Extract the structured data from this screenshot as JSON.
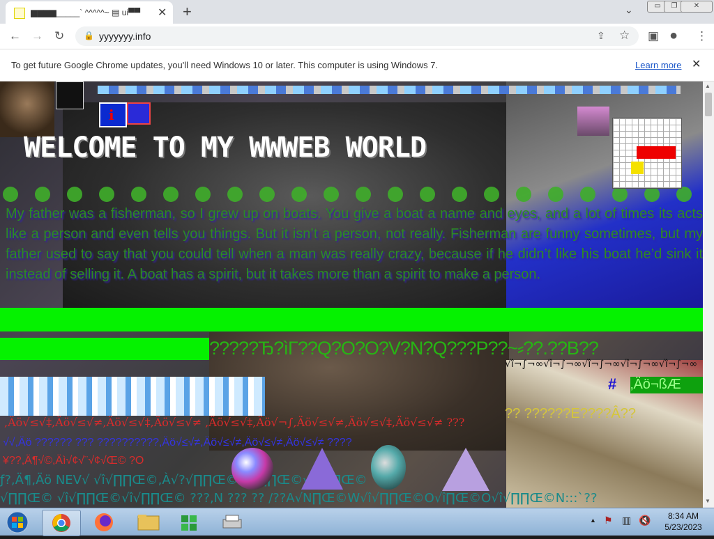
{
  "browser": {
    "tab_title": "▆▆▆▆_____` ^^^^^~ ▤ ui▀▀",
    "tab_close": "✕",
    "new_tab": "+",
    "tab_list": "⌄",
    "url": "yyyyyyy.info",
    "win_minimize": "▭",
    "win_restore": "❐",
    "win_close": "✕"
  },
  "infobar": {
    "message": "To get future Google Chrome updates, you'll need Windows 10 or later. This computer is using Windows 7.",
    "learn_more": "Learn more",
    "close": "✕"
  },
  "page": {
    "welcome": "WELCOME TO MY WWWEB WORLD",
    "story": "My father was a fisherman, so I grew up on boats. You give a boat a name and eyes, and a lot of times its acts like a person and even tells you things. But it isn’t a person, not really. Fisherman are funny sometimes, but my father used to say that you could tell when a man was really crazy, because if he didn’t like his boat he’d sink it instead of selling it. A boat has a spirit, but it takes more than a spirit to make a person.",
    "question_text": "?????Ђ?ìΓ??Q?O?O?V?N?Q???P??~⸗??.??B??",
    "sqrt_row": "√î¬∫¬∞√î¬∫¬∞√î¬∫¬∞√î¬∫¬∞√î¬∫¬∞",
    "hash_row": "#",
    "hash_green": "‚Äö¬ßÆ",
    "yellow_q": "??  ??????E????Â??",
    "red_row1": ",Äö√≤√‡,Äö√≤√≠,Äö√≤√‡,Äö√≤√≠ ,Äö√≤√‡,Äö√¬∫,Äö√≤√≠,Äö√≤√‡,Äö√≤√≠ ???",
    "red_row2": "√√,Äö ?????? ??? ??????????,Äö√≤√≠,Äö√≤√≠,Äö√≤√≠,Äö√≤√≠ ????",
    "red_row3": "¥??,Ä¶√©,Äì√¢√¨√¢√Œ© ?O",
    "teal_row1": "ƒ?,Ä¶,Äö NEV√ √î√∏∏Œ©,À√?√∏∏Œ©√î√∏∏Œ©√î√∏∏Œ©",
    "teal_row2": "√∏∏Œ© √î√∏∏Œ©√î√∏∏Œ© ???,N ??? ?? /??A√N∏Œ©W√î√∏∏Œ©O√î∏Œ©O√î√∏∏Œ©N:::`??"
  },
  "taskbar": {
    "time": "8:34 AM",
    "date": "5/23/2023"
  },
  "icons": [
    "back-icon",
    "forward-icon",
    "reload-icon",
    "lock-icon",
    "share-icon",
    "star-icon",
    "sidepanel-icon",
    "profile-icon",
    "menu-icon",
    "start-icon",
    "chrome-icon",
    "firefox-icon",
    "folder-icon",
    "network-icon",
    "printer-icon"
  ]
}
